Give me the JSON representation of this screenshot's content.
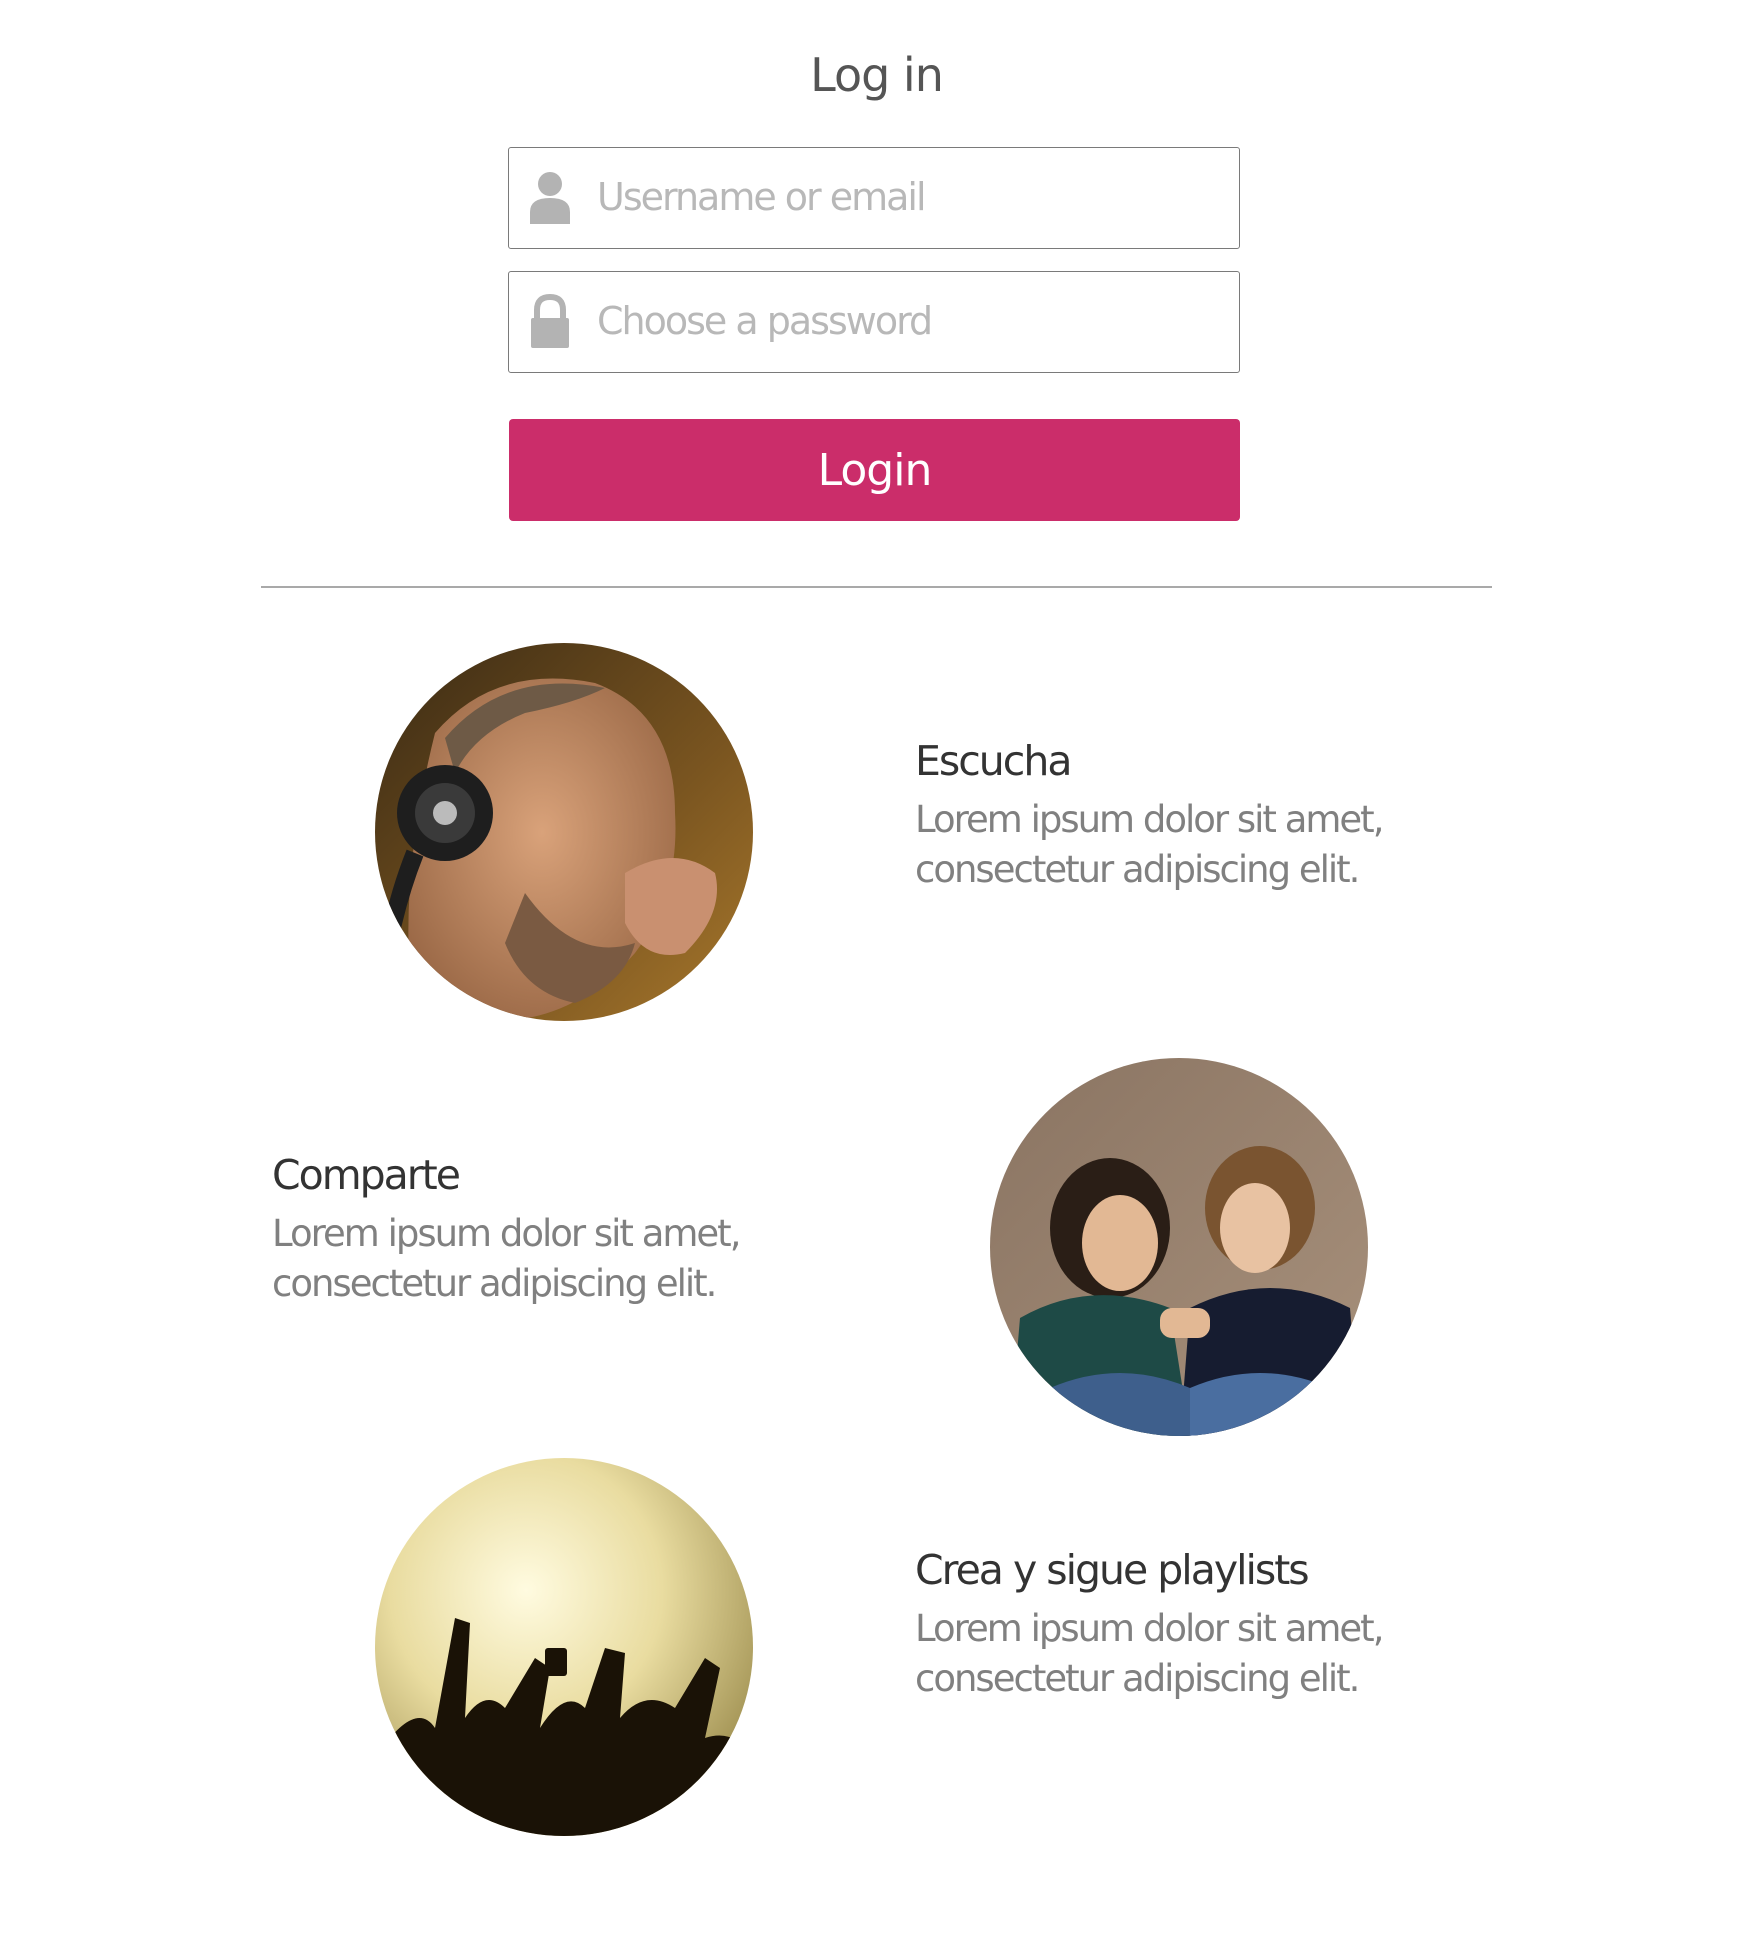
{
  "header": {
    "title": "Log in"
  },
  "form": {
    "username": {
      "placeholder": "Username or email",
      "value": "",
      "icon": "user-icon"
    },
    "password": {
      "placeholder": "Choose a password",
      "value": "",
      "icon": "lock-icon"
    },
    "submit_label": "Login"
  },
  "features": [
    {
      "title": "Escucha",
      "line1": "Lorem ipsum dolor sit amet,",
      "line2": "consectetur adipiscing elit.",
      "image": "man-with-headphones-photo"
    },
    {
      "title": "Comparte",
      "line1": "Lorem ipsum dolor sit amet,",
      "line2": "consectetur adipiscing elit.",
      "image": "two-friends-sharing-earphones-photo"
    },
    {
      "title": "Crea y sigue playlists",
      "line1": "Lorem ipsum dolor sit amet,",
      "line2": "consectetur adipiscing elit.",
      "image": "concert-crowd-photo"
    }
  ],
  "colors": {
    "accent": "#cb2d6a",
    "heading": "#333333",
    "body_text": "#808080",
    "placeholder": "#b8b8b8",
    "icon": "#b3b3b3",
    "divider": "#a9a9a9"
  }
}
